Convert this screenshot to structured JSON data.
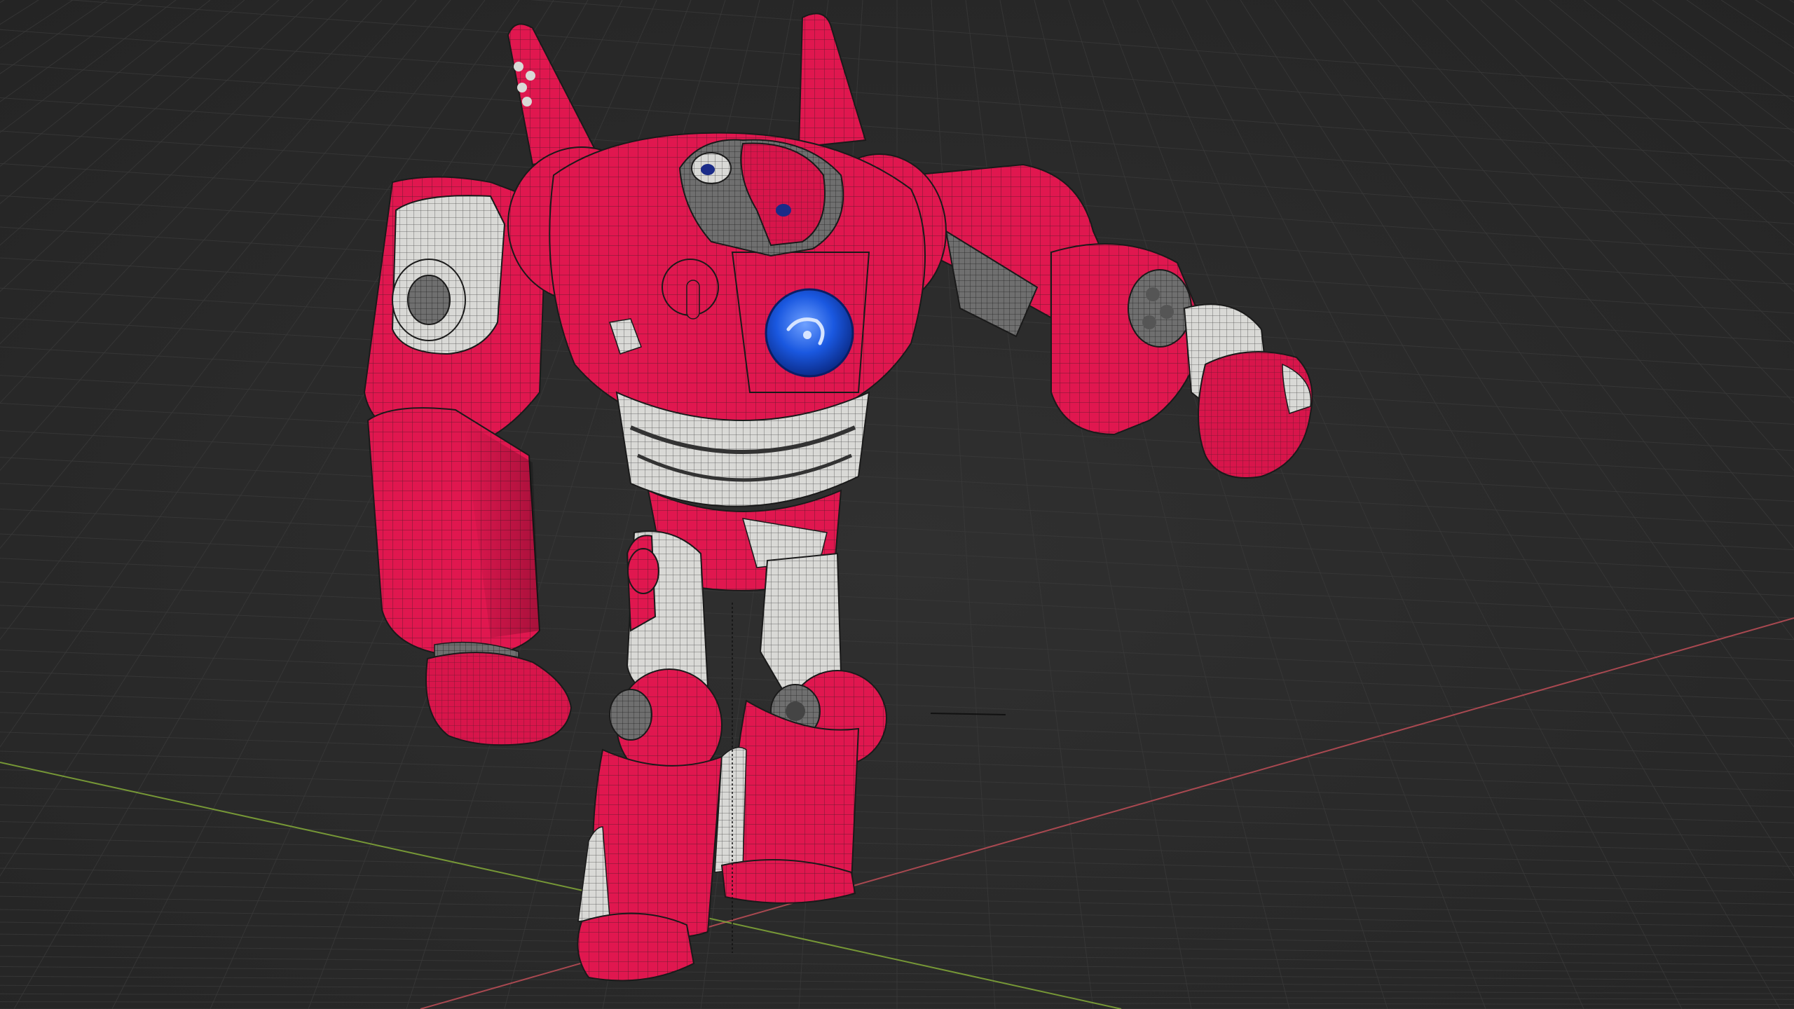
{
  "viewport": {
    "background_color": "#2b2b2b",
    "vignette_color": "#262626",
    "grid_line_color": "#3a3a3a",
    "x_axis_color": "#c8505a",
    "y_axis_color": "#8ab33a"
  },
  "model": {
    "armor_color": "#e0174f",
    "armor_highlight_color": "#f2416e",
    "armor_shadow_color": "#a60f38",
    "panel_color": "#d9d9d6",
    "joint_color": "#6f6f6f",
    "core_color": "#1a58e0",
    "wire_color": "#1a1a1a",
    "display_mode": "wireframe-overlay"
  }
}
